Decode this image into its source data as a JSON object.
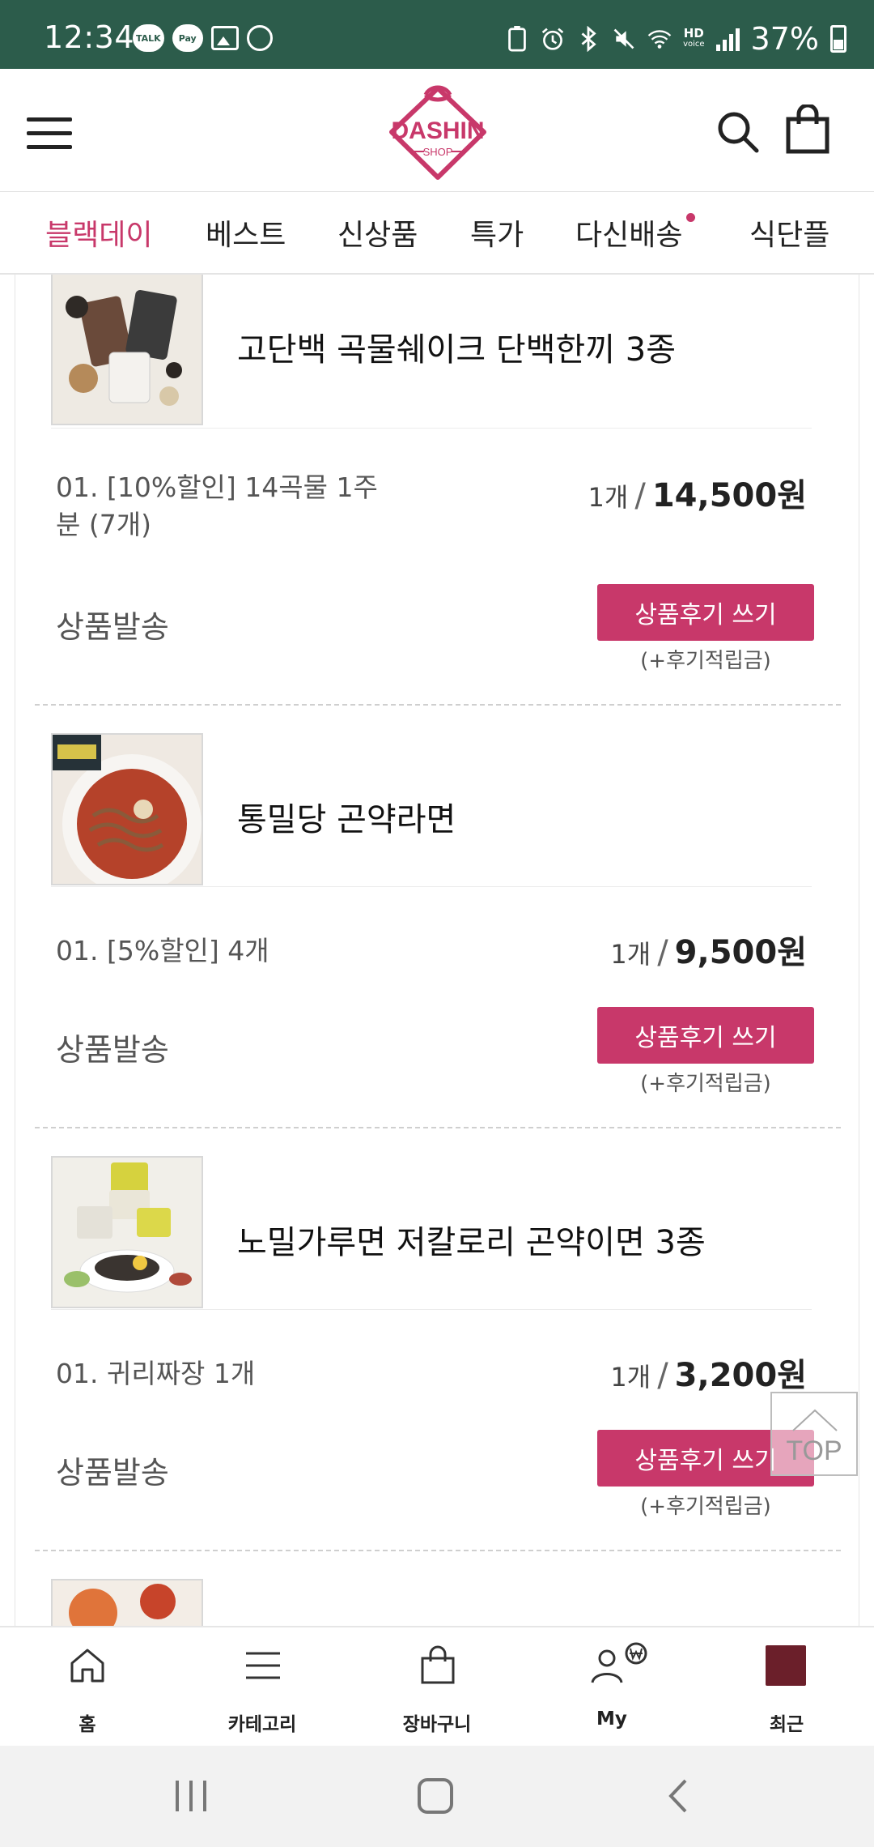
{
  "status_bar": {
    "time": "12:34",
    "left_icons": [
      "TALK",
      "Pay"
    ],
    "hd_top": "HD",
    "hd_bottom": "voice",
    "battery": "37%"
  },
  "header": {
    "logo_text": "DASHIN",
    "logo_sub": "SHOP"
  },
  "tabs": [
    {
      "label": "블랙데이"
    },
    {
      "label": "베스트"
    },
    {
      "label": "신상품"
    },
    {
      "label": "특가"
    },
    {
      "label": "다신배송"
    },
    {
      "label": "식단플"
    }
  ],
  "products": [
    {
      "name": "고단백 곡물쉐이크 단백한끼 3종",
      "option": "01. [10%할인] 14곡물 1주분 (7개)",
      "qty": "1개",
      "slash": "/",
      "price": "14,500원",
      "status": "상품발송",
      "review_button": "상품후기 쓰기",
      "reward_note": "(+후기적립금)"
    },
    {
      "name": "통밀당 곤약라면",
      "option": "01. [5%할인] 4개",
      "qty": "1개",
      "slash": "/",
      "price": "9,500원",
      "status": "상품발송",
      "review_button": "상품후기 쓰기",
      "reward_note": "(+후기적립금)"
    },
    {
      "name": "노밀가루면 저칼로리 곤약이면 3종",
      "option": "01. 귀리짜장 1개",
      "qty": "1개",
      "slash": "/",
      "price": "3,200원",
      "status": "상품발송",
      "review_button": "상품후기 쓰기",
      "reward_note": "(+후기적립금)"
    }
  ],
  "top_button": "TOP",
  "bottom_nav": [
    {
      "label": "홈",
      "icon": "home-icon"
    },
    {
      "label": "카테고리",
      "icon": "menu-icon"
    },
    {
      "label": "장바구니",
      "icon": "shopping-bag-icon"
    },
    {
      "label": "My",
      "icon": "user-won-icon"
    },
    {
      "label": "최근",
      "icon": "recent-product-thumbnail"
    }
  ],
  "colors": {
    "status_bar": "#2c5c4b",
    "accent": "#c8386a"
  }
}
